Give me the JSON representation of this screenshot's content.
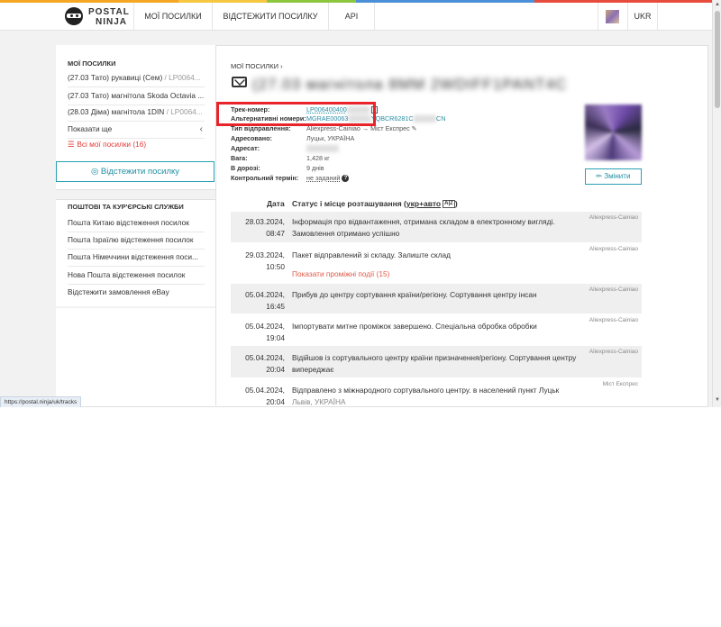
{
  "nav": {
    "brand_line1": "POSTAL",
    "brand_line2": "NINJA",
    "items": [
      "МОЇ ПОСИЛКИ",
      "ВІДСТЕЖИТИ ПОСИЛКУ",
      "API"
    ],
    "lang": "UKR",
    "rainbow": [
      "#f5a623",
      "#f5a623",
      "#f8c741",
      "#8cc63f",
      "#4a90d9",
      "#4a90d9",
      "#e74c3c",
      "#e74c3c"
    ]
  },
  "sidebar": {
    "my_title": "МОЇ ПОСИЛКИ",
    "parcels": [
      {
        "name": "(27.03 Тато) рукавиці (Сем)",
        "code": "/ LP0064..."
      },
      {
        "name": "(27.03 Тато) магнітола Skoda Octavia ...",
        "code": ""
      },
      {
        "name": "(28.03 Діма) магнітола 1DIN",
        "code": "/ LP0064..."
      }
    ],
    "show_more": "Показати ще",
    "all_label": "Всі мої посилки (16)",
    "track_button": "Відстежити посилку",
    "services_title": "ПОШТОВІ ТА КУР'ЄРСЬКІ СЛУЖБИ",
    "services": [
      "Пошта Китаю відстеження посилок",
      "Пошта Ізраїлю відстеження посилок",
      "Пошта Німеччини відстеження поси...",
      "Нова Пошта відстеження посилок",
      "Відстежити замовлення eBay"
    ]
  },
  "main": {
    "breadcrumb": "МОЇ ПОСИЛКИ",
    "breadcrumb_sep": "›",
    "title": "(27.03 магнітола 8MM 2WDIFF1PANT4C",
    "info": [
      {
        "label": "Трек-номер:",
        "value": "LP006400400",
        "blur": "▒▒▒▒▒",
        "kind": "track"
      },
      {
        "label": "Альтернативні номери:",
        "value": "MGRAE00063",
        "value2": "YQBCR6281C",
        "value3": "CN",
        "blur": "▒▒▒▒▒",
        "kind": "alt"
      },
      {
        "label": "Тип відправлення:",
        "value": "Aliexpress-Cainiao → Міст Експрес",
        "kind": "type"
      },
      {
        "label": "Адресовано:",
        "value": "Луцьк, УКРАЇНА",
        "kind": "plain"
      },
      {
        "label": "Адресат:",
        "value": "▒▒▒▒▒▒▒",
        "kind": "blur"
      },
      {
        "label": "Вага:",
        "value": "1,428 кг",
        "kind": "plain"
      },
      {
        "label": "В дорозі:",
        "value": "9 днів",
        "kind": "plain"
      },
      {
        "label": "Контрольний термін:",
        "value": "не заданий",
        "kind": "deadline"
      }
    ],
    "change_button": "Змінити",
    "table": {
      "date_header": "Дата",
      "status_header": "Статус і місце розташування (",
      "status_header_link": "укр+авто",
      "az_icon": "A|Z",
      "status_header_close": ")"
    },
    "events": [
      {
        "date1": "28.03.2024,",
        "date2": "08:47",
        "text": "Інформація про відвантаження, отримана складом в електронному вигляді. Замовлення отримано успішно",
        "src": "Aliexpress-Cainiao",
        "extra": "",
        "loc": ""
      },
      {
        "date1": "29.03.2024,",
        "date2": "10:50",
        "text": "Пакет відправлений зі складу. Залиште склад",
        "src": "Aliexpress-Cainiao",
        "extra": "Показати проміжні події (15)",
        "loc": ""
      },
      {
        "date1": "05.04.2024,",
        "date2": "16:45",
        "text": "Прибув до центру сортування країни/регіону. Сортування центру інсан",
        "src": "Aliexpress-Cainiao",
        "extra": "",
        "loc": ""
      },
      {
        "date1": "05.04.2024,",
        "date2": "19:04",
        "text": "Імпортувати митне проміжок завершено. Спеціальна обробка обробки",
        "src": "Aliexpress-Cainiao",
        "extra": "",
        "loc": ""
      },
      {
        "date1": "05.04.2024,",
        "date2": "20:04",
        "text": "Відійшов із сортувального центру країни призначення/регіону. Сортування центру випереджає",
        "src": "Aliexpress-Cainiao",
        "extra": "",
        "loc": ""
      },
      {
        "date1": "05.04.2024,",
        "date2": "20:04",
        "text": "Відправлено з міжнародного сортувального центру. в населений пункт Луцьк",
        "src": "Міст Експрес",
        "extra": "",
        "loc": "Львів, УКРАЇНА"
      }
    ]
  },
  "status_bar": {
    "url": "https://postal.ninja/uk/tracks"
  }
}
